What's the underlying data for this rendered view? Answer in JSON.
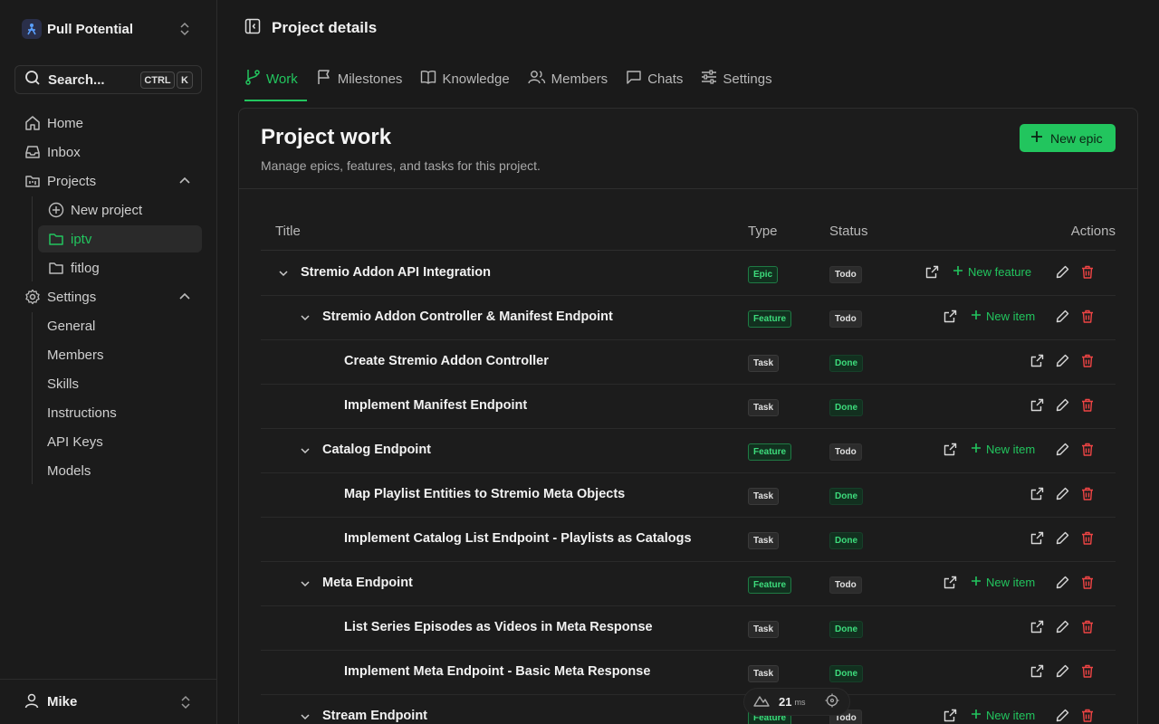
{
  "workspace": {
    "name": "Pull Potential"
  },
  "search": {
    "label": "Search...",
    "kbd_ctrl": "CTRL",
    "kbd_k": "K"
  },
  "nav": {
    "home": "Home",
    "inbox": "Inbox",
    "projects": "Projects",
    "new_project": "New project",
    "projects_list": [
      "iptv",
      "fitlog"
    ],
    "settings": "Settings",
    "settings_items": [
      "General",
      "Members",
      "Skills",
      "Instructions",
      "API Keys",
      "Models"
    ]
  },
  "user": {
    "name": "Mike"
  },
  "page": {
    "title": "Project details"
  },
  "tabs": [
    "Work",
    "Milestones",
    "Knowledge",
    "Members",
    "Chats",
    "Settings"
  ],
  "work": {
    "title": "Project work",
    "subtitle": "Manage epics, features, and tasks for this project.",
    "new_epic": "New epic",
    "columns": {
      "title": "Title",
      "type": "Type",
      "status": "Status",
      "actions": "Actions"
    },
    "rows": [
      {
        "level": 0,
        "title": "Stremio Addon API Integration",
        "type": "Epic",
        "status": "Todo",
        "add": "New feature"
      },
      {
        "level": 1,
        "title": "Stremio Addon Controller & Manifest Endpoint",
        "type": "Feature",
        "status": "Todo",
        "add": "New item"
      },
      {
        "level": 2,
        "title": "Create Stremio Addon Controller",
        "type": "Task",
        "status": "Done",
        "add": ""
      },
      {
        "level": 2,
        "title": "Implement Manifest Endpoint",
        "type": "Task",
        "status": "Done",
        "add": ""
      },
      {
        "level": 1,
        "title": "Catalog Endpoint",
        "type": "Feature",
        "status": "Todo",
        "add": "New item"
      },
      {
        "level": 2,
        "title": "Map Playlist Entities to Stremio Meta Objects",
        "type": "Task",
        "status": "Done",
        "add": ""
      },
      {
        "level": 2,
        "title": "Implement Catalog List Endpoint - Playlists as Catalogs",
        "type": "Task",
        "status": "Done",
        "add": ""
      },
      {
        "level": 1,
        "title": "Meta Endpoint",
        "type": "Feature",
        "status": "Todo",
        "add": "New item"
      },
      {
        "level": 2,
        "title": "List Series Episodes as Videos in Meta Response",
        "type": "Task",
        "status": "Done",
        "add": ""
      },
      {
        "level": 2,
        "title": "Implement Meta Endpoint - Basic Meta Response",
        "type": "Task",
        "status": "Done",
        "add": ""
      },
      {
        "level": 1,
        "title": "Stream Endpoint",
        "type": "Feature",
        "status": "Todo",
        "add": "New item"
      }
    ]
  },
  "perf": {
    "value": "21",
    "unit": "ms"
  },
  "colors": {
    "accent": "#22c55e",
    "danger": "#ef4444",
    "background": "#1a1a1a"
  }
}
